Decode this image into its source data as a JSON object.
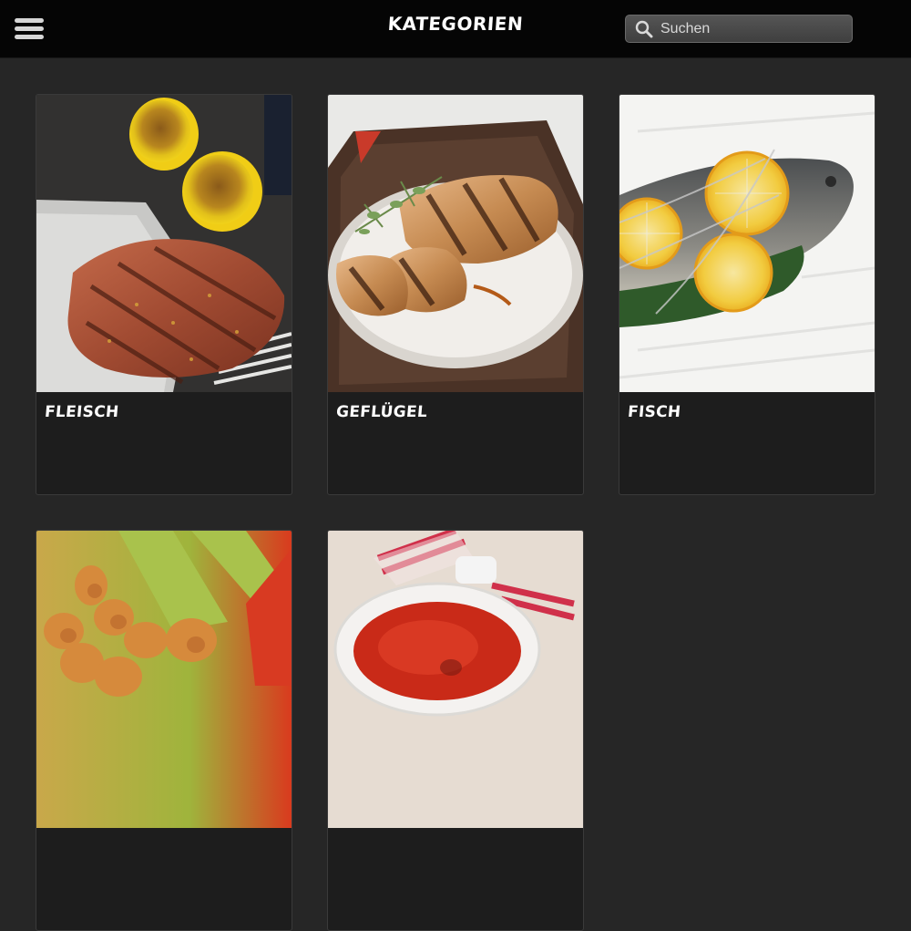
{
  "header": {
    "title": "KATEGORIEN",
    "menu_icon": "hamburger-menu-icon",
    "search": {
      "placeholder": "Suchen",
      "value": "",
      "icon": "search-icon"
    }
  },
  "categories": [
    {
      "label": "FLEISCH",
      "image": "grilled-steak-with-lemons"
    },
    {
      "label": "GEFLÜGEL",
      "image": "grilled-chicken-breast"
    },
    {
      "label": "FISCH",
      "image": "grilled-fish-with-lemon-slices"
    },
    {
      "label": "",
      "image": "bread-twists-on-skewers"
    },
    {
      "label": "",
      "image": "red-sauce-bowl"
    }
  ],
  "colors": {
    "background": "#262626",
    "topbar": "#050505",
    "card": "#1d1d1d",
    "text": "#ffffff"
  }
}
